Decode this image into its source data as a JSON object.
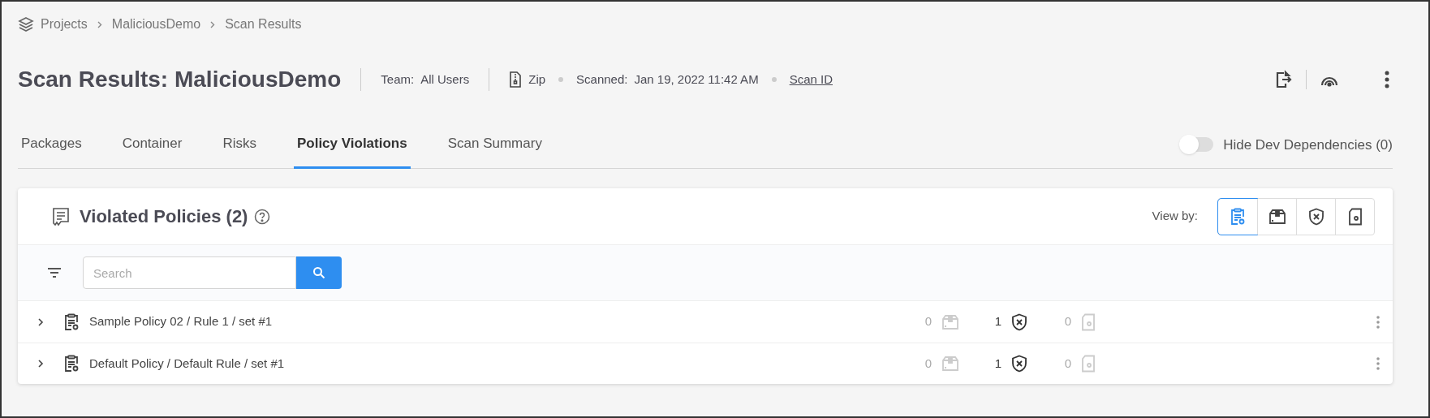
{
  "breadcrumb": [
    "Projects",
    "MaliciousDemo",
    "Scan Results"
  ],
  "header": {
    "title": "Scan Results: MaliciousDemo",
    "team_label": "Team:",
    "team": "All Users",
    "source": "Zip",
    "scanned_label": "Scanned:",
    "scanned": "Jan 19, 2022 11:42 AM",
    "scan_id_link": "Scan ID"
  },
  "tabs": [
    {
      "label": "Packages",
      "selected": false
    },
    {
      "label": "Container",
      "selected": false
    },
    {
      "label": "Risks",
      "selected": false
    },
    {
      "label": "Policy Violations",
      "selected": true
    },
    {
      "label": "Scan Summary",
      "selected": false
    }
  ],
  "dev_toggle": {
    "label": "Hide Dev Dependencies (0)",
    "on": false
  },
  "panel": {
    "title": "Violated Policies (2)",
    "view_by_label": "View by:",
    "view_by": [
      {
        "kind": "policy",
        "selected": true
      },
      {
        "kind": "package",
        "selected": false
      },
      {
        "kind": "risk",
        "selected": false
      },
      {
        "kind": "license",
        "selected": false
      }
    ],
    "search": {
      "placeholder": "Search"
    },
    "rows": [
      {
        "name": "Sample Policy 02 / Rule 1 / set #1",
        "expanded": false,
        "counts": [
          {
            "kind": "package",
            "value": "0",
            "active": false
          },
          {
            "kind": "risk",
            "value": "1",
            "active": true
          },
          {
            "kind": "license",
            "value": "0",
            "active": false
          }
        ]
      },
      {
        "name": "Default Policy / Default Rule / set #1",
        "expanded": false,
        "counts": [
          {
            "kind": "package",
            "value": "0",
            "active": false
          },
          {
            "kind": "risk",
            "value": "1",
            "active": true
          },
          {
            "kind": "license",
            "value": "0",
            "active": false
          }
        ]
      }
    ]
  }
}
